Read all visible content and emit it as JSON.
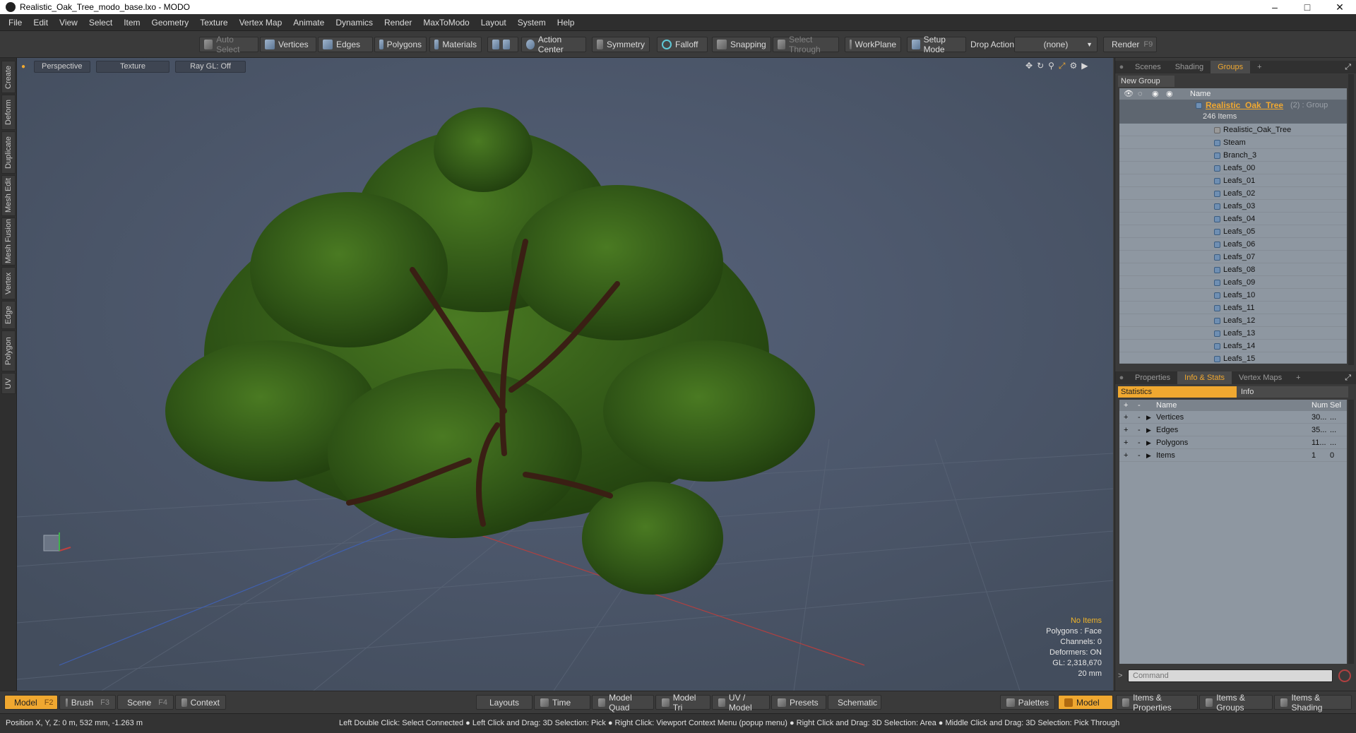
{
  "window": {
    "title": "Realistic_Oak_Tree_modo_base.lxo - MODO"
  },
  "menu": [
    "File",
    "Edit",
    "View",
    "Select",
    "Item",
    "Geometry",
    "Texture",
    "Vertex Map",
    "Animate",
    "Dynamics",
    "Render",
    "MaxToModo",
    "Layout",
    "System",
    "Help"
  ],
  "toolbar": {
    "auto_select": "Auto Select",
    "vertices": "Vertices",
    "edges": "Edges",
    "polygons": "Polygons",
    "materials": "Materials",
    "action_center": "Action Center",
    "symmetry": "Symmetry",
    "falloff": "Falloff",
    "snapping": "Snapping",
    "select_through": "Select Through",
    "workplane": "WorkPlane",
    "setup_mode": "Setup Mode",
    "drop_action": "Drop Action",
    "drop_value": "(none)",
    "render": "Render",
    "render_key": "F9"
  },
  "left_tabs": [
    "Create",
    "Deform",
    "Duplicate",
    "Mesh Edit",
    "Mesh Fusion",
    "Vertex",
    "Edge",
    "Polygon",
    "UV"
  ],
  "viewport": {
    "buttons": [
      "Perspective",
      "Texture",
      "Ray GL: Off"
    ],
    "info": {
      "selection": "No Items",
      "polygons": "Polygons : Face",
      "channels": "Channels: 0",
      "deformers": "Deformers: ON",
      "gl": "GL: 2,318,670",
      "scale": "20 mm"
    },
    "colors": {
      "background": "#4a5566",
      "foliage": "#355a1a",
      "bark": "#3a1f14"
    }
  },
  "groups_panel": {
    "tabs": [
      "Scenes",
      "Shading",
      "Groups"
    ],
    "active_tab": "Groups",
    "new_group": "New Group",
    "name_header": "Name",
    "group_name": "Realistic_Oak_Tree",
    "group_suffix": "(2) : Group",
    "item_count": "246 Items",
    "items": [
      "Realistic_Oak_Tree",
      "Steam",
      "Branch_3",
      "Leafs_00",
      "Leafs_01",
      "Leafs_02",
      "Leafs_03",
      "Leafs_04",
      "Leafs_05",
      "Leafs_06",
      "Leafs_07",
      "Leafs_08",
      "Leafs_09",
      "Leafs_10",
      "Leafs_11",
      "Leafs_12",
      "Leafs_13",
      "Leafs_14",
      "Leafs_15"
    ]
  },
  "info_panel": {
    "tabs": [
      "Properties",
      "Info & Stats",
      "Vertex Maps"
    ],
    "active_tab": "Info & Stats",
    "subtabs": [
      "Statistics",
      "Info"
    ],
    "headers": {
      "name": "Name",
      "num": "Num",
      "sel": "Sel"
    },
    "rows": [
      {
        "name": "Vertices",
        "num": "30...",
        "sel": "..."
      },
      {
        "name": "Edges",
        "num": "35...",
        "sel": "..."
      },
      {
        "name": "Polygons",
        "num": "11...",
        "sel": "..."
      },
      {
        "name": "Items",
        "num": "1",
        "sel": "0"
      }
    ],
    "command_placeholder": "Command"
  },
  "bottom": {
    "left": [
      {
        "label": "Model",
        "key": "F2"
      },
      {
        "label": "Brush",
        "key": "F3"
      },
      {
        "label": "Scene",
        "key": "F4"
      },
      {
        "label": "Context",
        "key": ""
      }
    ],
    "center": [
      "Layouts",
      "Time",
      "Model Quad",
      "Model Tri",
      "UV / Model",
      "Presets",
      "Schematic"
    ],
    "right": [
      "Palettes",
      "Model",
      "Items & Properties",
      "Items & Groups",
      "Items & Shading"
    ]
  },
  "status": {
    "position": "Position X, Y, Z:   0 m, 532 mm, -1.263 m",
    "hint": "Left Double Click: Select Connected ● Left Click and Drag: 3D Selection: Pick ● Right Click: Viewport Context Menu (popup menu) ● Right Click and Drag: 3D Selection: Area ● Middle Click and Drag: 3D Selection: Pick Through"
  }
}
